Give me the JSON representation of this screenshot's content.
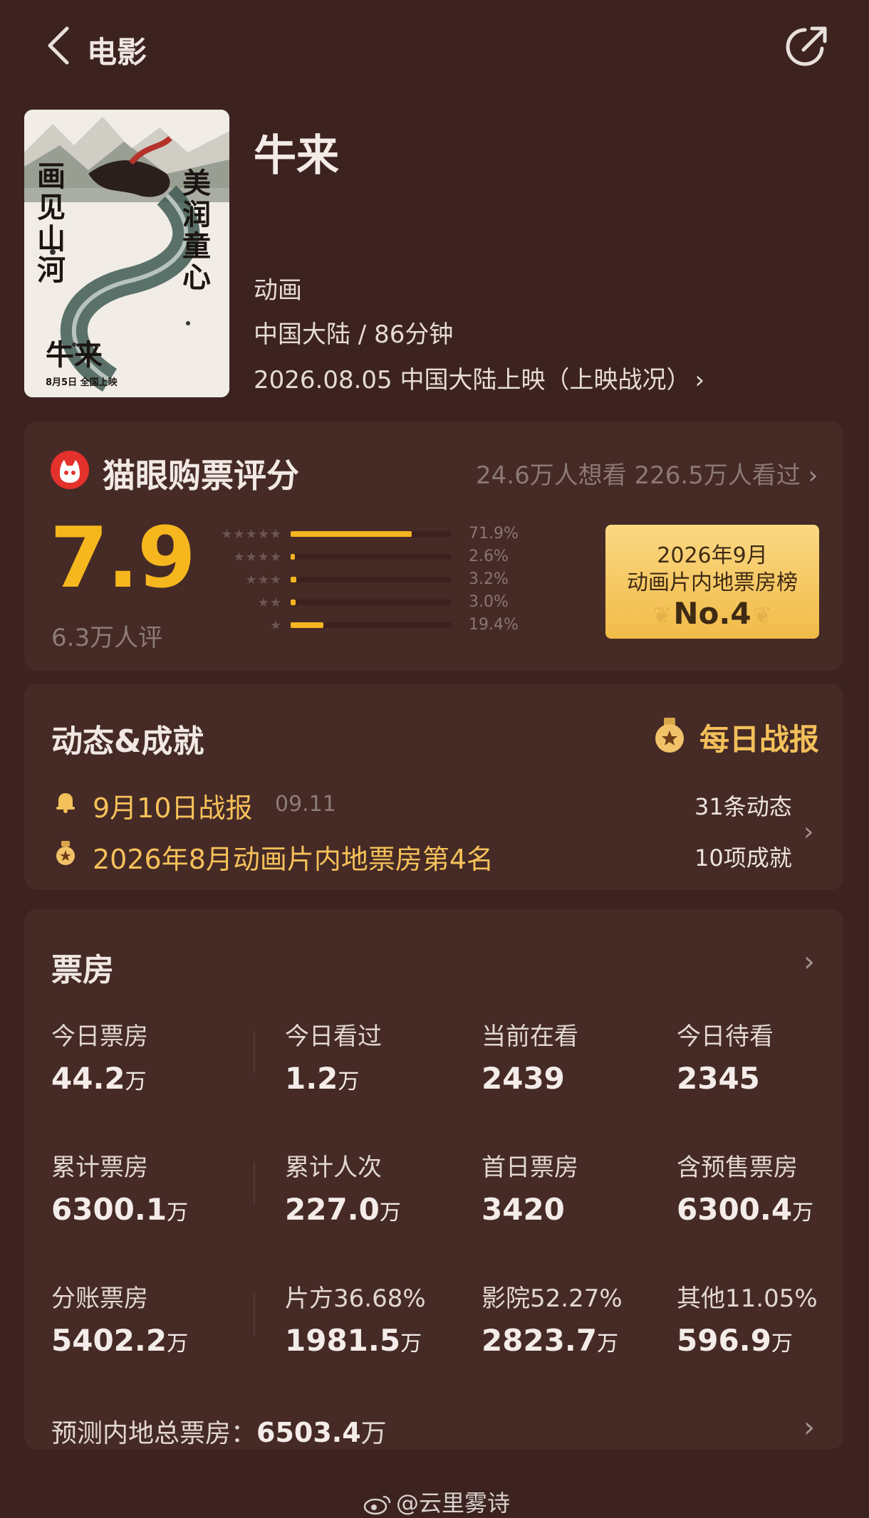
{
  "header": {
    "back_label": "电影"
  },
  "movie": {
    "title": "牛来",
    "genre": "动画",
    "region_duration": "中国大陆 / 86分钟",
    "release": "2026.08.05 中国大陆上映（上映战况）",
    "poster": {
      "left_text": "画见山河",
      "right_text": "美润童心",
      "title_text": "牛来",
      "date_text": "8月5日  全国上映"
    }
  },
  "rating": {
    "label": "猫眼购票评分",
    "audience": "24.6万人想看 226.5万人看过",
    "score": "7.9",
    "count": "6.3万人评",
    "distribution": [
      {
        "stars": 5,
        "percent_text": "71.9%",
        "percent": 71.9
      },
      {
        "stars": 4,
        "percent_text": "2.6%",
        "percent": 2.6
      },
      {
        "stars": 3,
        "percent_text": "3.2%",
        "percent": 3.2
      },
      {
        "stars": 2,
        "percent_text": "3.0%",
        "percent": 3.0
      },
      {
        "stars": 1,
        "percent_text": "19.4%",
        "percent": 19.4
      }
    ],
    "rank_badge": {
      "line1": "2026年9月",
      "line2": "动画片内地票房榜",
      "rank": "No.4"
    }
  },
  "news": {
    "title": "动态&成就",
    "daily_label": "每日战报",
    "item1": "9月10日战报",
    "item1_date": "09.11",
    "item2": "2026年8月动画片内地票房第4名",
    "count1": "31条动态",
    "count2": "10项成就"
  },
  "box_office": {
    "title": "票房",
    "stats": [
      {
        "label": "今日票房",
        "value": "44.2",
        "unit": "万"
      },
      {
        "label": "今日看过",
        "value": "1.2",
        "unit": "万"
      },
      {
        "label": "当前在看",
        "value": "2439",
        "unit": ""
      },
      {
        "label": "今日待看",
        "value": "2345",
        "unit": ""
      },
      {
        "label": "累计票房",
        "value": "6300.1",
        "unit": "万"
      },
      {
        "label": "累计人次",
        "value": "227.0",
        "unit": "万"
      },
      {
        "label": "首日票房",
        "value": "3420",
        "unit": ""
      },
      {
        "label": "含预售票房",
        "value": "6300.4",
        "unit": "万"
      },
      {
        "label": "分账票房",
        "value": "5402.2",
        "unit": "万"
      },
      {
        "label": "片方36.68%",
        "value": "1981.5",
        "unit": "万"
      },
      {
        "label": "影院52.27%",
        "value": "2823.7",
        "unit": "万"
      },
      {
        "label": "其他11.05%",
        "value": "596.9",
        "unit": "万"
      }
    ],
    "forecast_label": "预测内地总票房：",
    "forecast_value": "6503.4",
    "forecast_unit": "万"
  },
  "watermark": "@云里雾诗",
  "colors": {
    "accent": "#f6b71e",
    "background": "#3c2320",
    "card": "#452a26"
  }
}
